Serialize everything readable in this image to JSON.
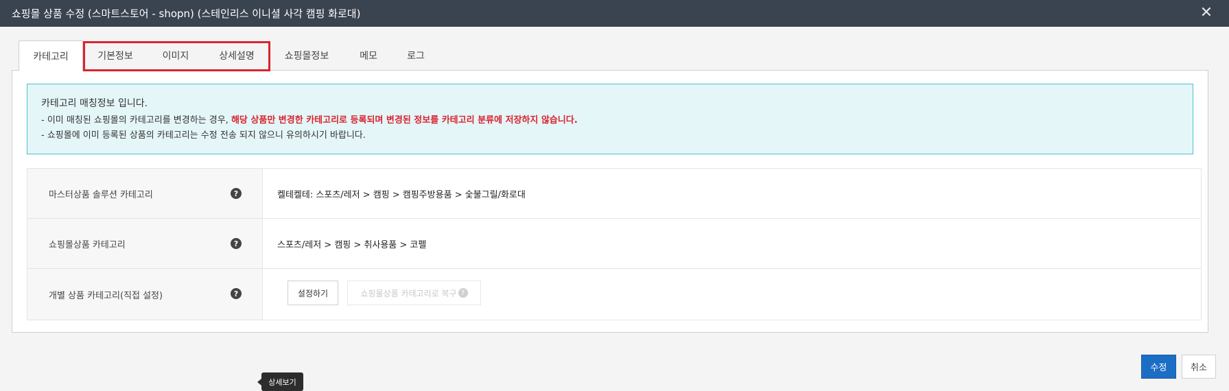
{
  "window": {
    "title": "쇼핑몰 상품 수정 (스마트스토어 - shopn) (스테인리스 이니셜 사각 캠핑 화로대)",
    "close": "✕"
  },
  "tabs": [
    "카테고리",
    "기본정보",
    "이미지",
    "상세설명",
    "쇼핑몰정보",
    "메모",
    "로그"
  ],
  "notice": {
    "line1": "카테고리 매칭정보 입니다.",
    "line2_prefix": "- 이미 매칭된 쇼핑몰의 카테고리를 변경하는 경우, ",
    "line2_highlight": "해당 상품만 변경한 카테고리로 등록되며 변경된 정보를 카테고리 분류에 저장하지 않습니다.",
    "line3": "- 쇼핑몰에 이미 등록된 상품의 카테고리는 수정 전송 되지 않으니 유의하시기 바랍니다."
  },
  "rows": [
    {
      "label": "마스터상품 솔루션 카테고리",
      "value": "켈테켈테: 스포츠/레저 > 캠핑 > 캠핑주방용품 > 숯불그릴/화로대"
    },
    {
      "label": "쇼핑몰상품 카테고리",
      "value": "스포츠/레저 > 캠핑 > 취사용품 > 코펠"
    },
    {
      "label": "개별 상품 카테고리(직접 설정)",
      "set_button": "설정하기",
      "restore_button": "쇼핑몰상품 카테고리로 복구"
    }
  ],
  "help_glyph": "?",
  "footer": {
    "submit": "수정",
    "cancel": "취소"
  },
  "tooltip": "상세보기",
  "colors": {
    "titlebar": "#3a4350",
    "accent": "#1c6ec5",
    "alert_red": "#d9232d",
    "notice_bg": "#e4f6f8"
  }
}
